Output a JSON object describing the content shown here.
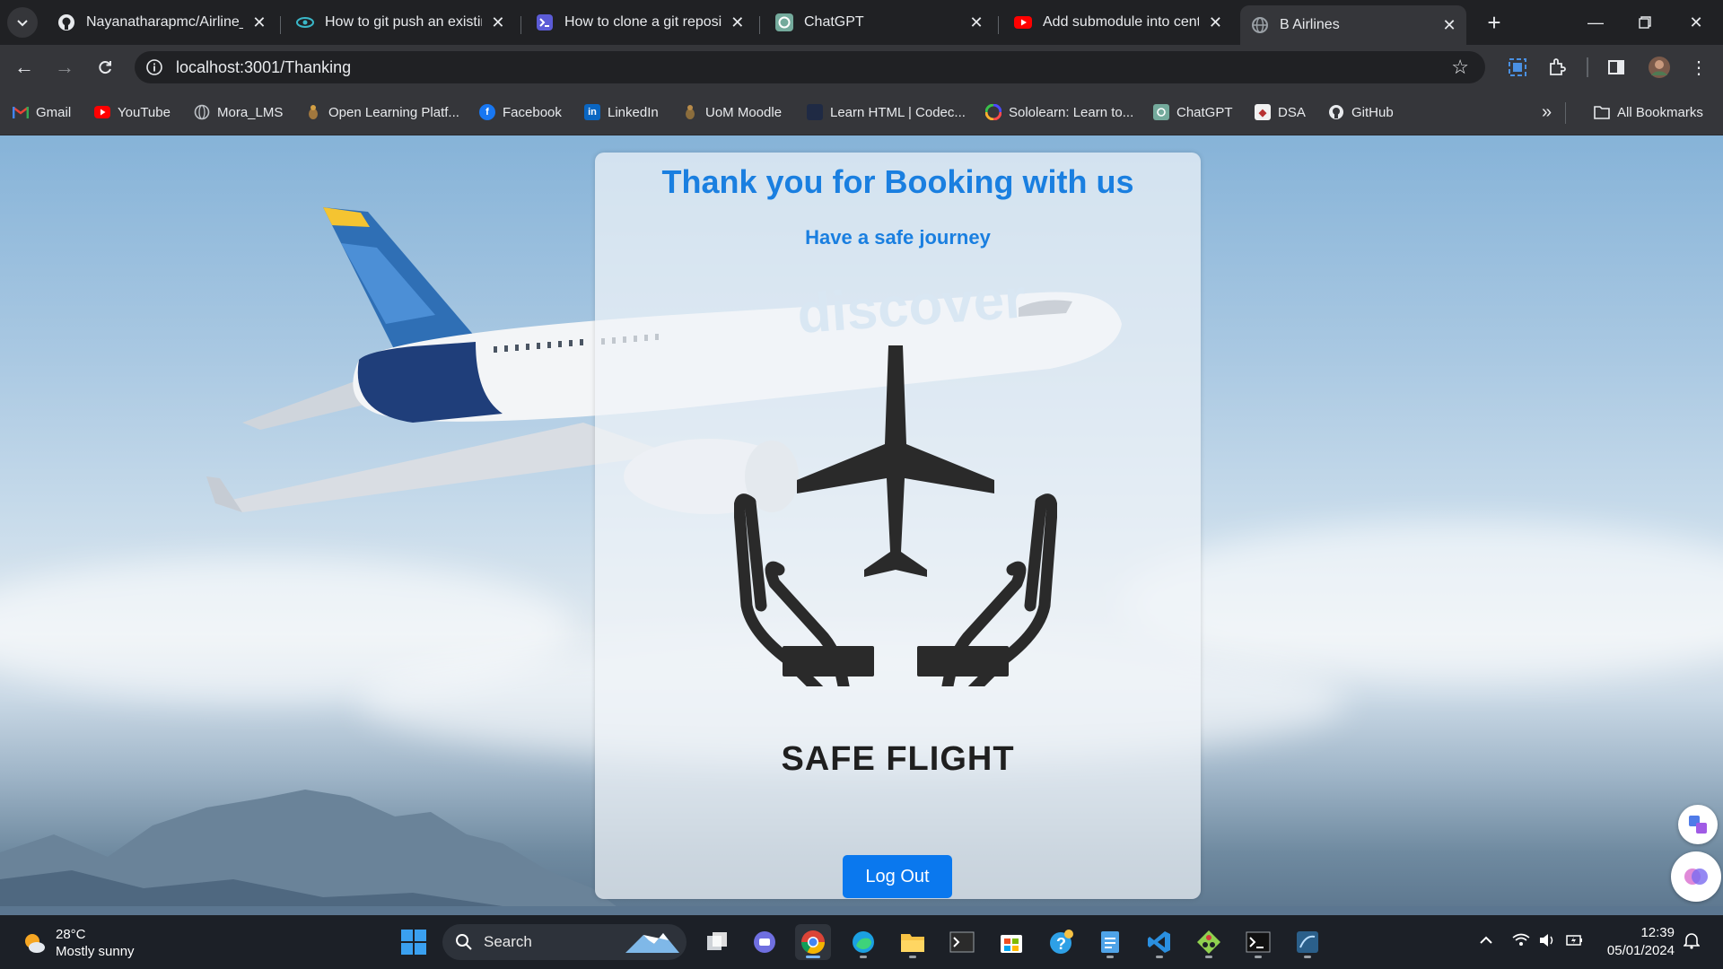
{
  "browser": {
    "tabs": [
      {
        "title": "Nayanatharapmc/Airline_R",
        "icon": "github-icon",
        "active": false
      },
      {
        "title": "How to git push an existing",
        "icon": "eye-icon",
        "active": false
      },
      {
        "title": "How to clone a git reposito",
        "icon": "terminal-icon",
        "active": false
      },
      {
        "title": "ChatGPT",
        "icon": "chatgpt-icon",
        "active": false
      },
      {
        "title": "Add submodule into centr",
        "icon": "youtube-icon",
        "active": false
      },
      {
        "title": "B Airlines",
        "icon": "globe-icon",
        "active": true
      }
    ],
    "url": "localhost:3001/Thanking",
    "bookmarks": [
      {
        "label": "Gmail",
        "icon": "gmail-icon"
      },
      {
        "label": "YouTube",
        "icon": "youtube-icon"
      },
      {
        "label": "Mora_LMS",
        "icon": "globe-icon"
      },
      {
        "label": "Open Learning Platf...",
        "icon": "open-learning-icon"
      },
      {
        "label": "Facebook",
        "icon": "facebook-icon"
      },
      {
        "label": "LinkedIn",
        "icon": "linkedin-icon"
      },
      {
        "label": "UoM Moodle",
        "icon": "moodle-icon"
      },
      {
        "label": "Learn HTML | Codec...",
        "icon": "codecademy-icon"
      },
      {
        "label": "Sololearn: Learn to...",
        "icon": "sololearn-icon"
      },
      {
        "label": "ChatGPT",
        "icon": "chatgpt-icon"
      },
      {
        "label": "DSA",
        "icon": "dsa-icon"
      },
      {
        "label": "GitHub",
        "icon": "github-icon"
      }
    ],
    "all_bookmarks": "All Bookmarks"
  },
  "page": {
    "heading": "Thank you for Booking with us",
    "subheading": "Have a safe journey",
    "illustration_caption": "SAFE FLIGHT",
    "logout_label": "Log Out",
    "colors": {
      "accent": "#1a7fe0",
      "button": "#0a78ee"
    }
  },
  "taskbar": {
    "weather_temp": "28°C",
    "weather_desc": "Mostly sunny",
    "search_label": "Search",
    "time": "12:39",
    "date": "05/01/2024"
  }
}
